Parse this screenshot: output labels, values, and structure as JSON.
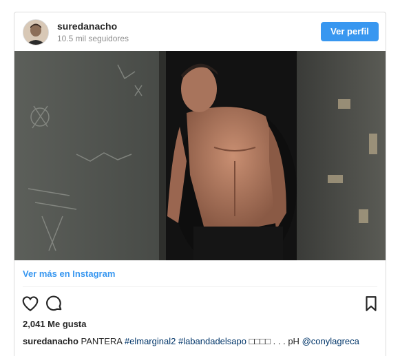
{
  "header": {
    "username": "suredanacho",
    "followers": "10.5 mil seguidores",
    "view_profile": "Ver perfil"
  },
  "footer": {
    "more_link": "Ver más en Instagram",
    "likes": "2,041 Me gusta"
  },
  "caption": {
    "user": "suredanacho",
    "text_pre": "PANTERA",
    "hashtag1": "#elmarginal2",
    "hashtag2": "#labandadelsapo",
    "text_mid": "□□□□ . . . pH",
    "mention": "@conylagreca"
  },
  "icons": {
    "like": "heart-icon",
    "comment": "comment-icon",
    "save": "bookmark-icon"
  },
  "colors": {
    "button": "#3897f0",
    "link": "#3897f0",
    "hashtag": "#003569"
  }
}
